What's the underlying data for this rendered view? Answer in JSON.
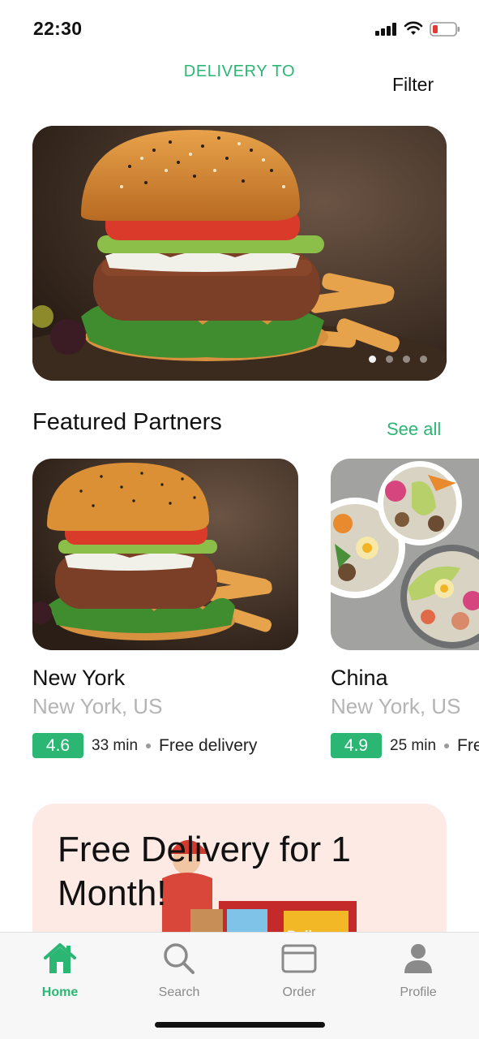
{
  "status_bar": {
    "time": "22:30"
  },
  "header": {
    "delivery_to": "DELIVERY TO",
    "filter": "Filter"
  },
  "hero": {
    "dots": 4,
    "active_dot": 0
  },
  "featured": {
    "title": "Featured Partners",
    "see_all": "See all",
    "partners": [
      {
        "name": "New York",
        "location": "New York, US",
        "rating": "4.6",
        "time": "33 min",
        "delivery": "Free delivery",
        "image": "burger"
      },
      {
        "name": "China",
        "location": "New York, US",
        "rating": "4.9",
        "time": "25 min",
        "delivery": "Free delivery",
        "image": "salad-bowls"
      }
    ]
  },
  "promo": {
    "text": "Free Delivery for 1 Month!",
    "badge": "Delivery"
  },
  "tabs": [
    {
      "label": "Home",
      "icon": "home-icon",
      "active": true
    },
    {
      "label": "Search",
      "icon": "search-icon",
      "active": false
    },
    {
      "label": "Order",
      "icon": "order-icon",
      "active": false
    },
    {
      "label": "Profile",
      "icon": "profile-icon",
      "active": false
    }
  ],
  "colors": {
    "accent": "#2bb673",
    "promo_bg": "#fdeae5"
  }
}
